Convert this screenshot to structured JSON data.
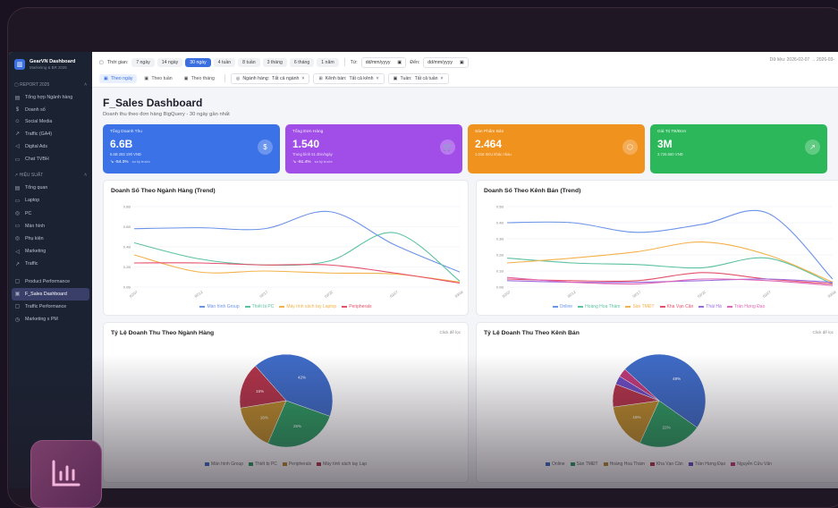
{
  "sidebar": {
    "brand_title": "GearVN Dashboard",
    "brand_sub": "Marketing & BR 2025",
    "section1": "REPORT 2025",
    "items1": [
      {
        "icon": "grid-icon",
        "glyph": "▤",
        "label": "Tổng hợp Ngành hàng"
      },
      {
        "icon": "dollar-icon",
        "glyph": "$",
        "label": "Doanh số"
      },
      {
        "icon": "users-icon",
        "glyph": "☺",
        "label": "Social Media"
      },
      {
        "icon": "trend-icon",
        "glyph": "↗",
        "label": "Traffic (GA4)"
      },
      {
        "icon": "bullhorn-icon",
        "glyph": "◁",
        "label": "Digital Ads"
      },
      {
        "icon": "chat-icon",
        "glyph": "▭",
        "label": "Chat TVBH"
      }
    ],
    "section2": "HIỆU SUẤT",
    "items2": [
      {
        "icon": "grid-icon",
        "glyph": "▤",
        "label": "Tổng quan"
      },
      {
        "icon": "laptop-icon",
        "glyph": "▭",
        "label": "Laptop"
      },
      {
        "icon": "database-icon",
        "glyph": "◎",
        "label": "PC"
      },
      {
        "icon": "monitor-icon",
        "glyph": "▭",
        "label": "Màn hình"
      },
      {
        "icon": "database-icon",
        "glyph": "◎",
        "label": "Phụ kiện"
      },
      {
        "icon": "bullhorn-icon",
        "glyph": "◁",
        "label": "Marketing"
      },
      {
        "icon": "trend-icon",
        "glyph": "↗",
        "label": "Traffic"
      }
    ],
    "items3": [
      {
        "icon": "box-icon",
        "glyph": "▢",
        "label": "Product Performance"
      },
      {
        "icon": "dashboard-icon",
        "glyph": "▣",
        "label": "F_Sales Dashboard",
        "active": true
      },
      {
        "icon": "file-icon",
        "glyph": "▢",
        "label": "Traffic Performance"
      },
      {
        "icon": "clock-icon",
        "glyph": "◷",
        "label": "Marketing x PM"
      }
    ]
  },
  "filters": {
    "time_label": "Thời gian:",
    "ranges": [
      "7 ngày",
      "14 ngày",
      "30 ngày",
      "4 tuần",
      "8 tuần",
      "3 tháng",
      "6 tháng",
      "1 năm"
    ],
    "selected_range": "30 ngày",
    "from_label": "Từ:",
    "from_placeholder": "dd/mm/yyyy",
    "to_label": "Đến:",
    "to_placeholder": "dd/mm/yyyy",
    "range_text": "Dữ liệu: 2026-02-07 → 2026-03-",
    "group_tabs": [
      "Theo ngày",
      "Theo tuần",
      "Theo tháng"
    ],
    "selected_group": "Theo ngày",
    "industry_label": "Ngành hàng:",
    "industry_value": "Tất cả ngành",
    "channel_label": "Kênh bán:",
    "channel_value": "Tất cả kênh",
    "week_label": "Tuần:",
    "week_value": "Tất cả tuần"
  },
  "page": {
    "title": "F_Sales Dashboard",
    "subtitle": "Doanh thu theo đơn hàng BigQuery - 30 ngày gần nhất"
  },
  "kpis": [
    {
      "label": "Tổng Doanh Thu",
      "value": "6.6B",
      "sub": "6.6B 283 190 VNĐ",
      "delta": "↘ -54.3%",
      "delta_note": "so kỳ trước",
      "icon": "dollar-icon",
      "glyph": "$",
      "color": "#3b72e8"
    },
    {
      "label": "Tổng Đơn Hàng",
      "value": "1.540",
      "sub": "Trung bình 51 đơn/ngày",
      "delta": "↘ -61.4%",
      "delta_note": "so kỳ trước",
      "icon": "cart-icon",
      "glyph": "🛒",
      "color": "#a14ee8"
    },
    {
      "label": "Sản Phẩm Bán",
      "value": "2.464",
      "sub": "1.016 SKU khác nhau",
      "delta": "",
      "delta_note": "",
      "icon": "box-icon",
      "glyph": "⬡",
      "color": "#f0921e"
    },
    {
      "label": "Giá Trị TB/Đơn",
      "value": "3M",
      "sub": "3.726.660 VNĐ",
      "delta": "",
      "delta_note": "",
      "icon": "trend-icon",
      "glyph": "↗",
      "color": "#2cb85a"
    }
  ],
  "charts": {
    "trend_industry_title": "Doanh Số Theo Ngành Hàng (Trend)",
    "trend_channel_title": "Doanh Số Theo Kênh Bán (Trend)",
    "pie_industry_title": "Tỷ Lệ Doanh Thu Theo Ngành Hàng",
    "pie_channel_title": "Tỷ Lệ Doanh Thu Theo Kênh Bán",
    "pie_link": "Click để lọc"
  },
  "chart_data": [
    {
      "type": "line",
      "title": "Doanh Số Theo Ngành Hàng (Trend)",
      "y_ticks": [
        "0.8B",
        "0.6B",
        "0.4B",
        "0.2B",
        "0.0B"
      ],
      "x": [
        "02/07",
        "02/12",
        "02/17",
        "02/22",
        "02/27",
        "03/04"
      ],
      "ylim": [
        0,
        0.8
      ],
      "series": [
        {
          "name": "Màn hình Group",
          "color": "#6b93e8",
          "values": [
            0.58,
            0.59,
            0.58,
            0.75,
            0.42,
            0.15
          ]
        },
        {
          "name": "Thiết bị PC",
          "color": "#5cc1a0",
          "values": [
            0.44,
            0.28,
            0.22,
            0.26,
            0.54,
            0.06
          ]
        },
        {
          "name": "Máy tính xách tay Laptop",
          "color": "#f3b24b",
          "values": [
            0.32,
            0.15,
            0.16,
            0.14,
            0.13,
            0.05
          ]
        },
        {
          "name": "Peripherals",
          "color": "#e3506a",
          "values": [
            0.24,
            0.24,
            0.22,
            0.22,
            0.14,
            0.04
          ]
        }
      ]
    },
    {
      "type": "line",
      "title": "Doanh Số Theo Kênh Bán (Trend)",
      "y_ticks": [
        "0.5B",
        "0.4B",
        "0.3B",
        "0.2B",
        "0.1B",
        "0.0B"
      ],
      "x": [
        "02/07",
        "02/12",
        "02/17",
        "02/22",
        "02/27",
        "03/04"
      ],
      "ylim": [
        0,
        0.5
      ],
      "series": [
        {
          "name": "Online",
          "color": "#6b93e8",
          "values": [
            0.4,
            0.4,
            0.34,
            0.39,
            0.46,
            0.05
          ]
        },
        {
          "name": "Hoàng Hoa Thám",
          "color": "#5cc1a0",
          "values": [
            0.18,
            0.15,
            0.14,
            0.12,
            0.18,
            0.02
          ]
        },
        {
          "name": "Sàn TMĐT",
          "color": "#f3b24b",
          "values": [
            0.15,
            0.18,
            0.22,
            0.28,
            0.2,
            0.03
          ]
        },
        {
          "name": "Kha Vạn Cân",
          "color": "#e3506a",
          "values": [
            0.05,
            0.04,
            0.04,
            0.09,
            0.05,
            0.02
          ]
        },
        {
          "name": "Thái Hà",
          "color": "#9b6be0",
          "values": [
            0.04,
            0.03,
            0.03,
            0.04,
            0.05,
            0.03
          ]
        },
        {
          "name": "Trần Hưng Đạo",
          "color": "#e066b5",
          "values": [
            0.06,
            0.03,
            0.02,
            0.05,
            0.04,
            0.01
          ]
        }
      ]
    },
    {
      "type": "pie",
      "title": "Tỷ Lệ Doanh Thu Theo Ngành Hàng",
      "slices": [
        {
          "name": "Màn hình Group",
          "value": 42,
          "label": "42%",
          "color": "#3f6bc6"
        },
        {
          "name": "Thiết bị PC",
          "value": 26,
          "label": "26%",
          "color": "#2e9a62"
        },
        {
          "name": "Peripherals",
          "value": 16,
          "label": "16%",
          "color": "#b98a2c"
        },
        {
          "name": "Máy tính xách tay Lap",
          "value": 16,
          "label": "16%",
          "color": "#b2344a"
        }
      ],
      "legend": [
        "Màn hình Group",
        "Thiết bị PC",
        "Peripherals",
        "Máy tính xách tay Lap"
      ]
    },
    {
      "type": "pie",
      "title": "Tỷ Lệ Doanh Thu Theo Kênh Bán",
      "slices": [
        {
          "name": "Online",
          "value": 48,
          "label": "48%",
          "color": "#3f6bc6"
        },
        {
          "name": "Sàn TMĐT",
          "value": 22,
          "label": "22%",
          "color": "#2e9a62"
        },
        {
          "name": "Hoàng Hoa Thám",
          "value": 16,
          "label": "16%",
          "color": "#b98a2c"
        },
        {
          "name": "Kha Vạn Cân",
          "value": 8,
          "label": "",
          "color": "#b2344a"
        },
        {
          "name": "Trần Hưng Đạo",
          "value": 3,
          "label": "",
          "color": "#6a4bc0"
        },
        {
          "name": "Nguyễn Cửu Vân",
          "value": 3,
          "label": "",
          "color": "#c0397a"
        }
      ],
      "legend": [
        "Online",
        "Sàn TMĐT",
        "Hoàng Hoa Thám",
        "Kha Vạn Cân",
        "Trần Hưng Đạo",
        "Nguyễn Cửu Vân"
      ]
    }
  ]
}
